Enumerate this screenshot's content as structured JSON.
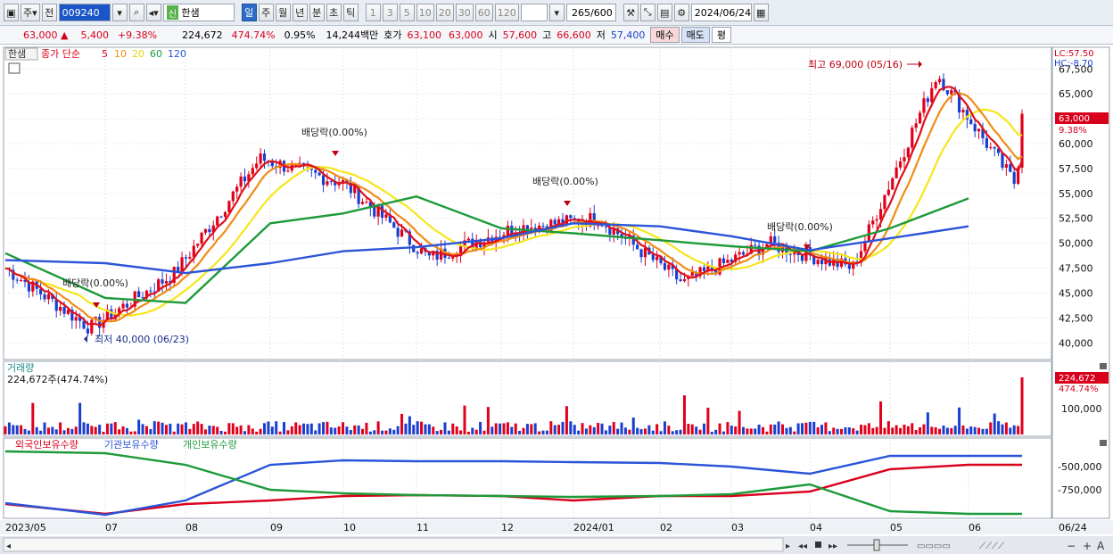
{
  "toolbar": {
    "market": "주",
    "prev": "전",
    "code": "009240",
    "name_badge": "신",
    "name": "한샘",
    "periods": [
      "일",
      "주",
      "월",
      "년",
      "분",
      "초",
      "틱"
    ],
    "intervals": [
      "1",
      "3",
      "5",
      "10",
      "20",
      "30",
      "60",
      "120"
    ],
    "count": "265",
    "count_total": "/600",
    "date": "2024/06/24"
  },
  "quote": {
    "price": "63,000",
    "arrow": "▲",
    "change": "5,400",
    "change_pct": "+9.38%",
    "volume": "224,672",
    "volume_pct": "474.74%",
    "turnover": "0.95%",
    "amount": "14,244백만",
    "hoga_label": "호가",
    "hoga1": "63,100",
    "hoga2": "63,000",
    "open_label": "시",
    "open": "57,600",
    "high_label": "고",
    "high": "66,600",
    "low_label": "저",
    "low": "57,400",
    "buy": "매수",
    "sell": "매도",
    "avg": "평"
  },
  "legend": {
    "name": "한샘",
    "ma_label": "종가 단순",
    "ma5": "5",
    "ma10": "10",
    "ma20": "20",
    "ma60": "60",
    "ma120": "120",
    "lc": "LC:57.50",
    "hc": "HC:-8.70"
  },
  "annotations": {
    "high": "최고 69,000 (05/16)",
    "low": "최저 40,000 (06/23)",
    "dividend": "배당락(0.00%)"
  },
  "price_axis": {
    "ticks": [
      "67,500",
      "65,000",
      "62,500",
      "60,000",
      "57,500",
      "55,000",
      "52,500",
      "50,000",
      "47,500",
      "45,000",
      "42,500",
      "40,000"
    ],
    "tick_values": [
      67500,
      65000,
      62500,
      60000,
      57500,
      55000,
      52500,
      50000,
      47500,
      45000,
      42500,
      40000
    ],
    "current": "63,000",
    "current_pct": "9.38%"
  },
  "volume_panel": {
    "title": "거래량",
    "info": "224,672주(474.74%)",
    "axis": "100,000",
    "current": "224,672",
    "current_pct": "474.74%"
  },
  "holding_panel": {
    "foreign": "외국인보유수량",
    "inst": "기관보유수량",
    "indiv": "개인보유수량",
    "axis1": "-500,000",
    "axis2": "-750,000"
  },
  "x_axis": {
    "labels": [
      "2023/05",
      "07",
      "08",
      "09",
      "10",
      "11",
      "12",
      "2024/01",
      "02",
      "03",
      "04",
      "05",
      "06"
    ],
    "end": "06/24"
  },
  "colors": {
    "up": "#e0001b",
    "down": "#1a3fd0",
    "ma5": "#e0101b",
    "ma10": "#f08c14",
    "ma20": "#f5e61a",
    "ma60": "#1e9a3a",
    "ma120": "#2b54d8"
  },
  "chart_data": {
    "type": "line",
    "title": "한샘 009240",
    "x": [
      "2023/05",
      "07",
      "08",
      "09",
      "10",
      "11",
      "12",
      "2024/01",
      "02",
      "03",
      "04",
      "05",
      "06"
    ],
    "series": [
      {
        "name": "종가",
        "values": [
          47500,
          41500,
          47000,
          58500,
          56000,
          48500,
          51500,
          52500,
          46000,
          50000,
          47500,
          67000,
          55000
        ]
      },
      {
        "name": "60",
        "values": [
          49000,
          44500,
          44000,
          52000,
          53000,
          54700,
          51500,
          51000,
          50300,
          49700,
          49200,
          51500,
          54500
        ]
      },
      {
        "name": "120",
        "values": [
          48300,
          48000,
          47000,
          48000,
          49200,
          49600,
          50500,
          52000,
          51700,
          50700,
          49300,
          50500,
          51700
        ]
      }
    ],
    "ylim": [
      38500,
      69500
    ]
  }
}
